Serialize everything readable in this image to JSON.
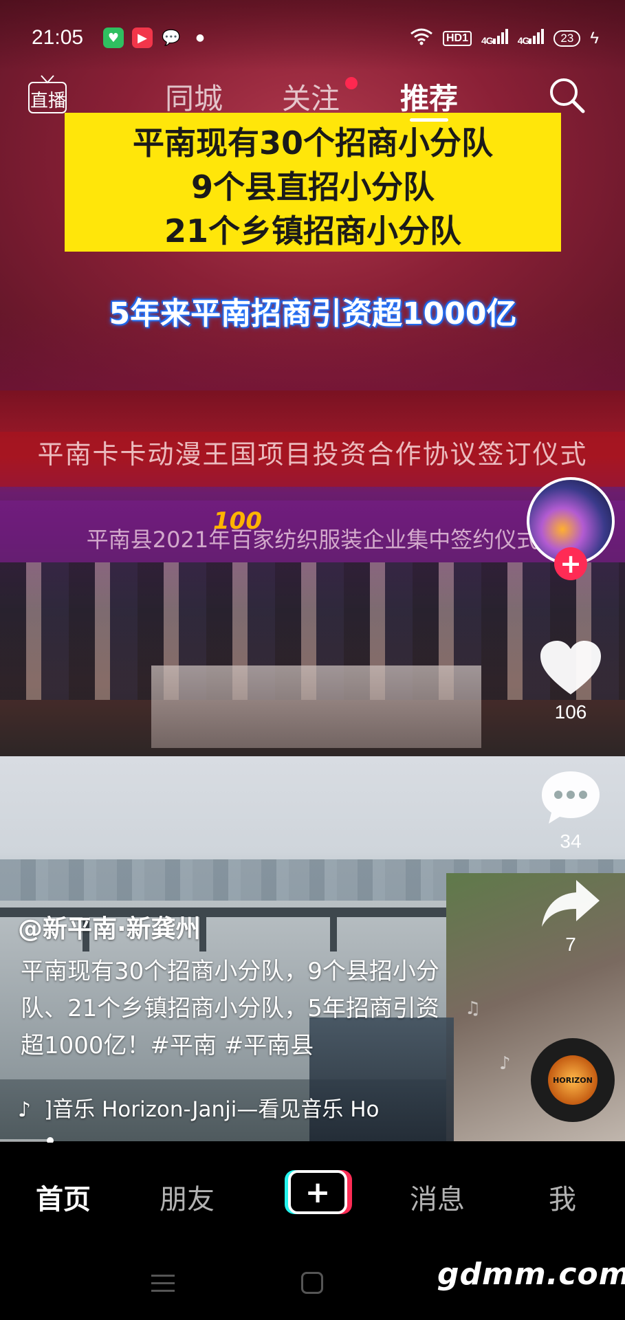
{
  "status_bar": {
    "time": "21:05",
    "hd_label": "HD1",
    "signal_1": "4G",
    "signal_2": "4G",
    "battery": "23"
  },
  "top_nav": {
    "live_label": "直播",
    "tabs": [
      {
        "label": "同城",
        "active": false
      },
      {
        "label": "关注",
        "active": false,
        "has_dot": true
      },
      {
        "label": "推荐",
        "active": true
      }
    ]
  },
  "video": {
    "yellow_lines": [
      "平南现有30个招商小分队",
      "9个县直招小分队",
      "21个乡镇招商小分队"
    ],
    "highlight_title": "5年来平南招商引资超1000亿",
    "banner_text_1": "平南卡卡动漫王国项目投资合作协议签订仪式",
    "banner_text_2": "平南县2021年百家纺织服装企业集中签约仪式"
  },
  "actions": {
    "like_count": "106",
    "comment_count": "34",
    "share_count": "7"
  },
  "post": {
    "author": "@新平南·新龚州",
    "description": "平南现有30个招商小分队，9个县招小分队、21个乡镇招商小分队，5年招商引资超1000亿！#平南 #平南县",
    "music": "]音乐   Horizon-Janji—看见音乐   Ho",
    "disc_label": "HORIZON"
  },
  "bottom_tabs": [
    {
      "label": "首页",
      "active": true
    },
    {
      "label": "朋友",
      "active": false
    },
    {
      "label": "消息",
      "active": false
    },
    {
      "label": "我",
      "active": false
    }
  ],
  "watermark": "gdmm.com",
  "colors": {
    "accent_red": "#fe2c55",
    "accent_cyan": "#25f4ee",
    "yellow_box": "#ffe60a"
  }
}
